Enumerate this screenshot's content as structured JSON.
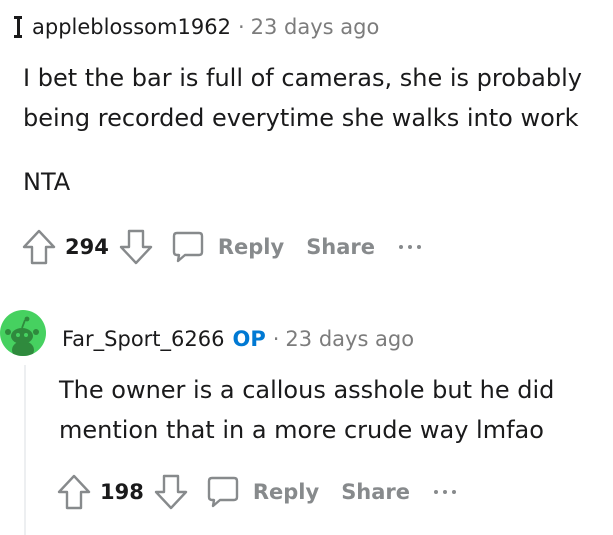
{
  "comments": [
    {
      "username": "appleblossom1962",
      "separator": "·",
      "time": "23 days ago",
      "body": [
        "I bet the bar is full of cameras, she is probably being recorded everytime she walks into work",
        "NTA"
      ],
      "score": "294",
      "reply_label": "Reply",
      "share_label": "Share"
    },
    {
      "username": "Far_Sport_6266",
      "op_badge": "OP",
      "separator": "·",
      "time": "23 days ago",
      "body": [
        "The owner is a callous asshole but he did mention that in a more crude way lmfao"
      ],
      "score": "198",
      "reply_label": "Reply",
      "share_label": "Share"
    }
  ],
  "colors": {
    "text": "#1a1a1b",
    "meta": "#7c7c7c",
    "action": "#878a8c",
    "op": "#0079d3",
    "avatar_bg": "#46d160"
  }
}
